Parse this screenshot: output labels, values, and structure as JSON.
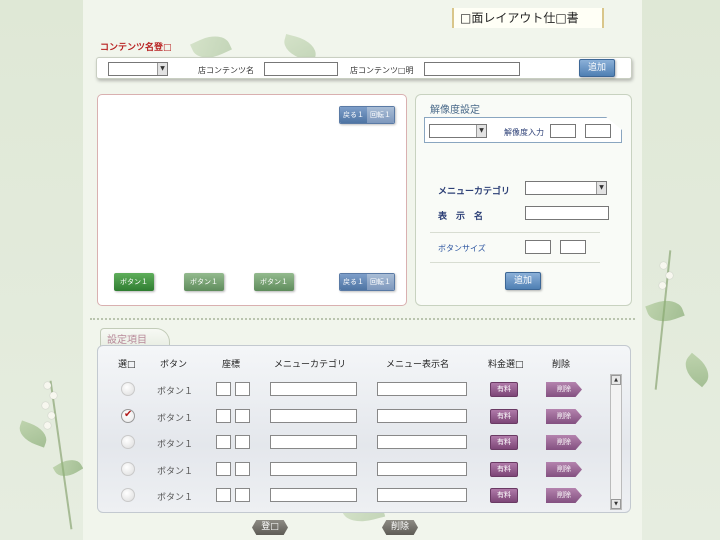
{
  "header": {
    "title": "□面レイアウト仕□書"
  },
  "content_register": {
    "section_label": "コンテンツ名登□",
    "select_value": "",
    "store_content_name_label": "店コンテンツ名",
    "store_content_name_value": "",
    "store_content_desc_label": "店コンテンツ□明",
    "store_content_desc_value": "",
    "add_label": "追加"
  },
  "preview": {
    "back_label": "戻る１",
    "rotate_label": "回転１",
    "green_buttons": [
      "ボタン１",
      "ボタン１",
      "ボタン１"
    ]
  },
  "resolution": {
    "title": "解像度設定",
    "select_value": "",
    "input_label": "解像度入力",
    "menu_category_label": "メニューカテゴリ",
    "display_name_label": "表　示　名",
    "button_size_label": "ボタンサイズ",
    "add_label": "追加"
  },
  "settings": {
    "tab_label": "設定項目",
    "columns": [
      "選□",
      "ボタン",
      "座標",
      "メニューカテゴリ",
      "メニュー表示名",
      "料金選□",
      "削除"
    ],
    "rows": [
      {
        "selected": false,
        "button": "ボタン１",
        "paid": "有料",
        "delete": "削除"
      },
      {
        "selected": true,
        "button": "ボタン１",
        "paid": "有料",
        "delete": "削除"
      },
      {
        "selected": false,
        "button": "ボタン１",
        "paid": "有料",
        "delete": "削除"
      },
      {
        "selected": false,
        "button": "ボタン１",
        "paid": "有料",
        "delete": "削除"
      },
      {
        "selected": false,
        "button": "ボタン１",
        "paid": "有料",
        "delete": "削除"
      }
    ]
  },
  "footer": {
    "register_label": "登□",
    "delete_label": "削除"
  }
}
